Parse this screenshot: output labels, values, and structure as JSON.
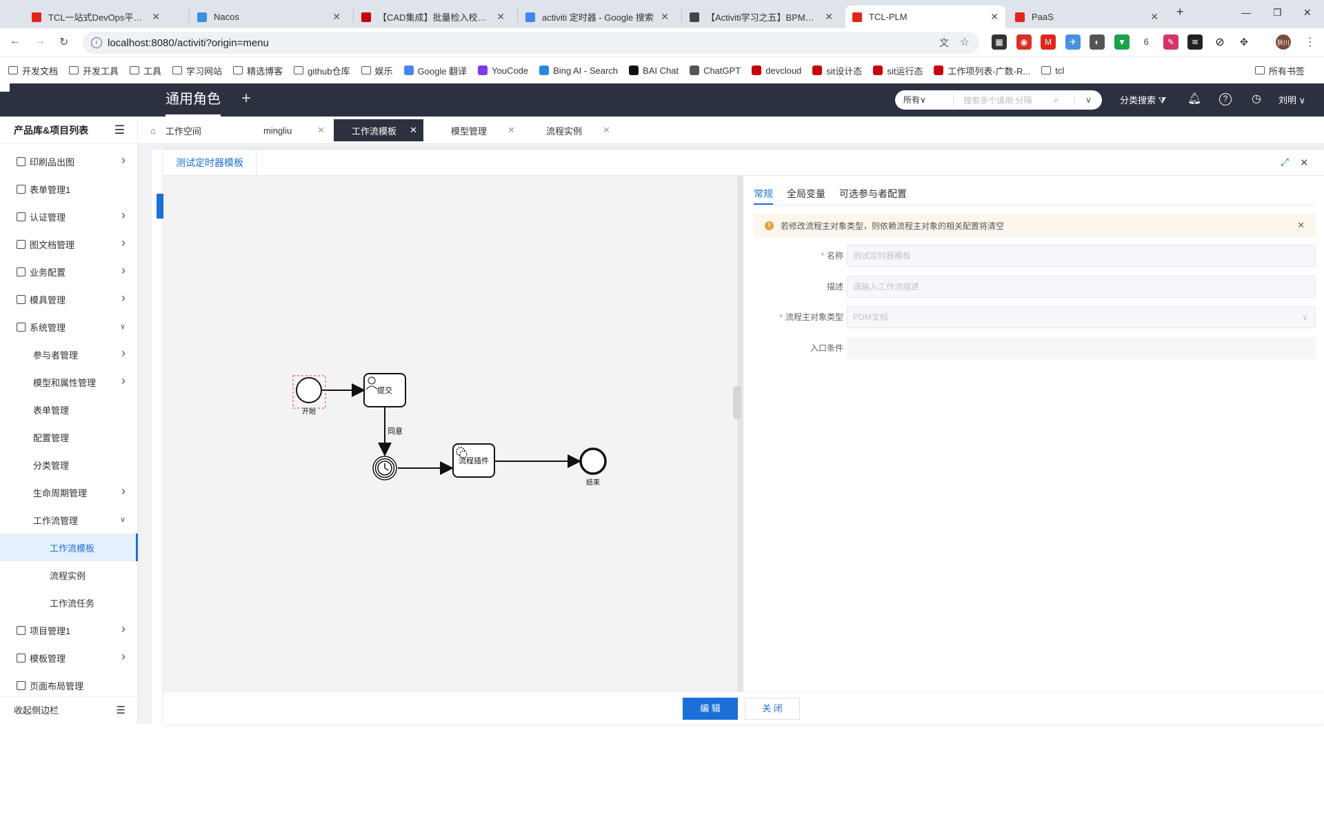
{
  "browser": {
    "tabs": [
      {
        "title": "TCL一站式DevOps平台——To",
        "favcolor": "#e1251b"
      },
      {
        "title": "Nacos",
        "favcolor": "#3a8ee6"
      },
      {
        "title": "【CAD集成】批量检入校验不通",
        "favcolor": "#c7000b"
      },
      {
        "title": "activiti 定时器 - Google 搜索",
        "favcolor": "#4285f4"
      },
      {
        "title": "【Activiti学习之五】BPMN事",
        "favcolor": "#444444"
      },
      {
        "title": "TCL-PLM",
        "favcolor": "#e1251b"
      },
      {
        "title": "PaaS",
        "favcolor": "#e1251b"
      }
    ],
    "new_tab": "+",
    "url": "localhost:8080/activiti?origin=menu",
    "bookmarks": [
      {
        "label": "开发文档",
        "type": "folder"
      },
      {
        "label": "开发工具",
        "type": "folder"
      },
      {
        "label": "工具",
        "type": "folder"
      },
      {
        "label": "学习网站",
        "type": "folder"
      },
      {
        "label": "精选博客",
        "type": "folder"
      },
      {
        "label": "github仓库",
        "type": "folder"
      },
      {
        "label": "娱乐",
        "type": "folder"
      },
      {
        "label": "Google 翻译",
        "type": "site",
        "color": "#4285f4"
      },
      {
        "label": "YouCode",
        "type": "site",
        "color": "#7c3aed"
      },
      {
        "label": "Bing AI - Search",
        "type": "site",
        "color": "#2b88d8"
      },
      {
        "label": "BAI Chat",
        "type": "site",
        "color": "#111111"
      },
      {
        "label": "ChatGPT",
        "type": "site",
        "color": "#555555"
      },
      {
        "label": "devcloud",
        "type": "site",
        "color": "#c7000b"
      },
      {
        "label": "sit设计态",
        "type": "site",
        "color": "#c7000b"
      },
      {
        "label": "sit运行态",
        "type": "site",
        "color": "#c7000b"
      },
      {
        "label": "工作项列表-广数-R...",
        "type": "site",
        "color": "#c7000b"
      },
      {
        "label": "tcl",
        "type": "folder"
      }
    ],
    "all_bookmarks": "所有书签",
    "avatar_text": "狄川"
  },
  "header": {
    "role": "通用角色",
    "search_scope": "所有",
    "search_placeholder": "搜索多个请用;分隔",
    "category_search": "分类搜索",
    "user": "刘明"
  },
  "sidebar": {
    "title": "产品库&项目列表",
    "items": [
      {
        "label": "印刷品出图",
        "level": 1,
        "arrow": "right"
      },
      {
        "label": "表单管理1",
        "level": 1,
        "arrow": ""
      },
      {
        "label": "认证管理",
        "level": 1,
        "arrow": "right"
      },
      {
        "label": "图文档管理",
        "level": 1,
        "arrow": "right"
      },
      {
        "label": "业务配置",
        "level": 1,
        "arrow": "right"
      },
      {
        "label": "模具管理",
        "level": 1,
        "arrow": "right"
      },
      {
        "label": "系统管理",
        "level": 1,
        "arrow": "down"
      },
      {
        "label": "参与者管理",
        "level": 2,
        "arrow": "right"
      },
      {
        "label": "模型和属性管理",
        "level": 2,
        "arrow": "right"
      },
      {
        "label": "表单管理",
        "level": 2,
        "arrow": ""
      },
      {
        "label": "配置管理",
        "level": 2,
        "arrow": ""
      },
      {
        "label": "分类管理",
        "level": 2,
        "arrow": ""
      },
      {
        "label": "生命周期管理",
        "level": 2,
        "arrow": "right"
      },
      {
        "label": "工作流管理",
        "level": 2,
        "arrow": "down"
      },
      {
        "label": "工作流模板",
        "level": 3,
        "arrow": "",
        "active": true
      },
      {
        "label": "流程实例",
        "level": 3,
        "arrow": ""
      },
      {
        "label": "工作流任务",
        "level": 3,
        "arrow": ""
      },
      {
        "label": "项目管理1",
        "level": 1,
        "arrow": "right"
      },
      {
        "label": "模板管理",
        "level": 1,
        "arrow": "right"
      },
      {
        "label": "页面布局管理",
        "level": 1,
        "arrow": ""
      }
    ],
    "collapse": "收起侧边栏"
  },
  "page_tabs": [
    {
      "label": "工作空间",
      "closable": false
    },
    {
      "label": "mingliu",
      "closable": true
    },
    {
      "label": "工作流模板",
      "closable": true,
      "active": true
    },
    {
      "label": "模型管理",
      "closable": true
    },
    {
      "label": "流程实例",
      "closable": true
    }
  ],
  "dialog": {
    "title": "测试定时器模板",
    "diagram": {
      "start_label": "开始",
      "submit_label": "提交",
      "edge_label": "同意",
      "plugin_label": "流程插件",
      "end_label": "结束"
    },
    "props_tabs": [
      "常规",
      "全局变量",
      "可选参与者配置"
    ],
    "alert": "若修改流程主对象类型，则依赖流程主对象的相关配置将清空",
    "fields": [
      {
        "label": "名称",
        "required": true,
        "value": "测试定时器模板"
      },
      {
        "label": "描述",
        "required": false,
        "value": "请输入工作流描述"
      },
      {
        "label": "流程主对象类型",
        "required": true,
        "value": "PDM文档"
      },
      {
        "label": "入口条件",
        "required": false,
        "value": ""
      }
    ],
    "edit_button": "编 辑",
    "close_button": "关 闭"
  }
}
